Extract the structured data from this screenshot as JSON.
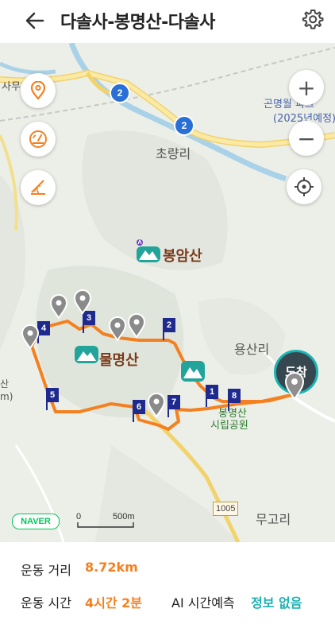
{
  "header": {
    "title": "다솔사-봉명산-다솔사"
  },
  "map": {
    "places": {
      "choryangri": "초량리",
      "bongamsan": "봉암산",
      "mulmyeongsan": "물명산",
      "yongsanri": "용산리",
      "mugori": "무고리",
      "gonmyeong_park": "곤명월 파크",
      "gonmyeong_year": "(2025년예정)",
      "samu": "사무소",
      "park_name": "봉명산",
      "park_sub": "시립공원",
      "left_edge_a": "산",
      "left_edge_b": "m)"
    },
    "road_numbers": {
      "r2a": "2",
      "r2b": "2",
      "r1005": "1005"
    },
    "waypoints": [
      "1",
      "2",
      "3",
      "4",
      "5",
      "6",
      "7",
      "8"
    ],
    "arrival_label": "도착",
    "naver_logo": "NAVER",
    "scale_start": "0",
    "scale_end": "500m",
    "controls": {
      "zoom_in": "+",
      "zoom_out": "−"
    }
  },
  "stats": {
    "distance_label": "운동 거리",
    "distance_value": "8.72km",
    "time_label": "운동 시간",
    "time_value": "4시간 2분",
    "ai_label": "AI 시간예측",
    "ai_value": "정보 없음"
  },
  "colors": {
    "route": "#f4801f",
    "accent_orange": "#f4801f",
    "accent_teal": "#1bb3b3",
    "flag_blue": "#1f2a8f"
  }
}
